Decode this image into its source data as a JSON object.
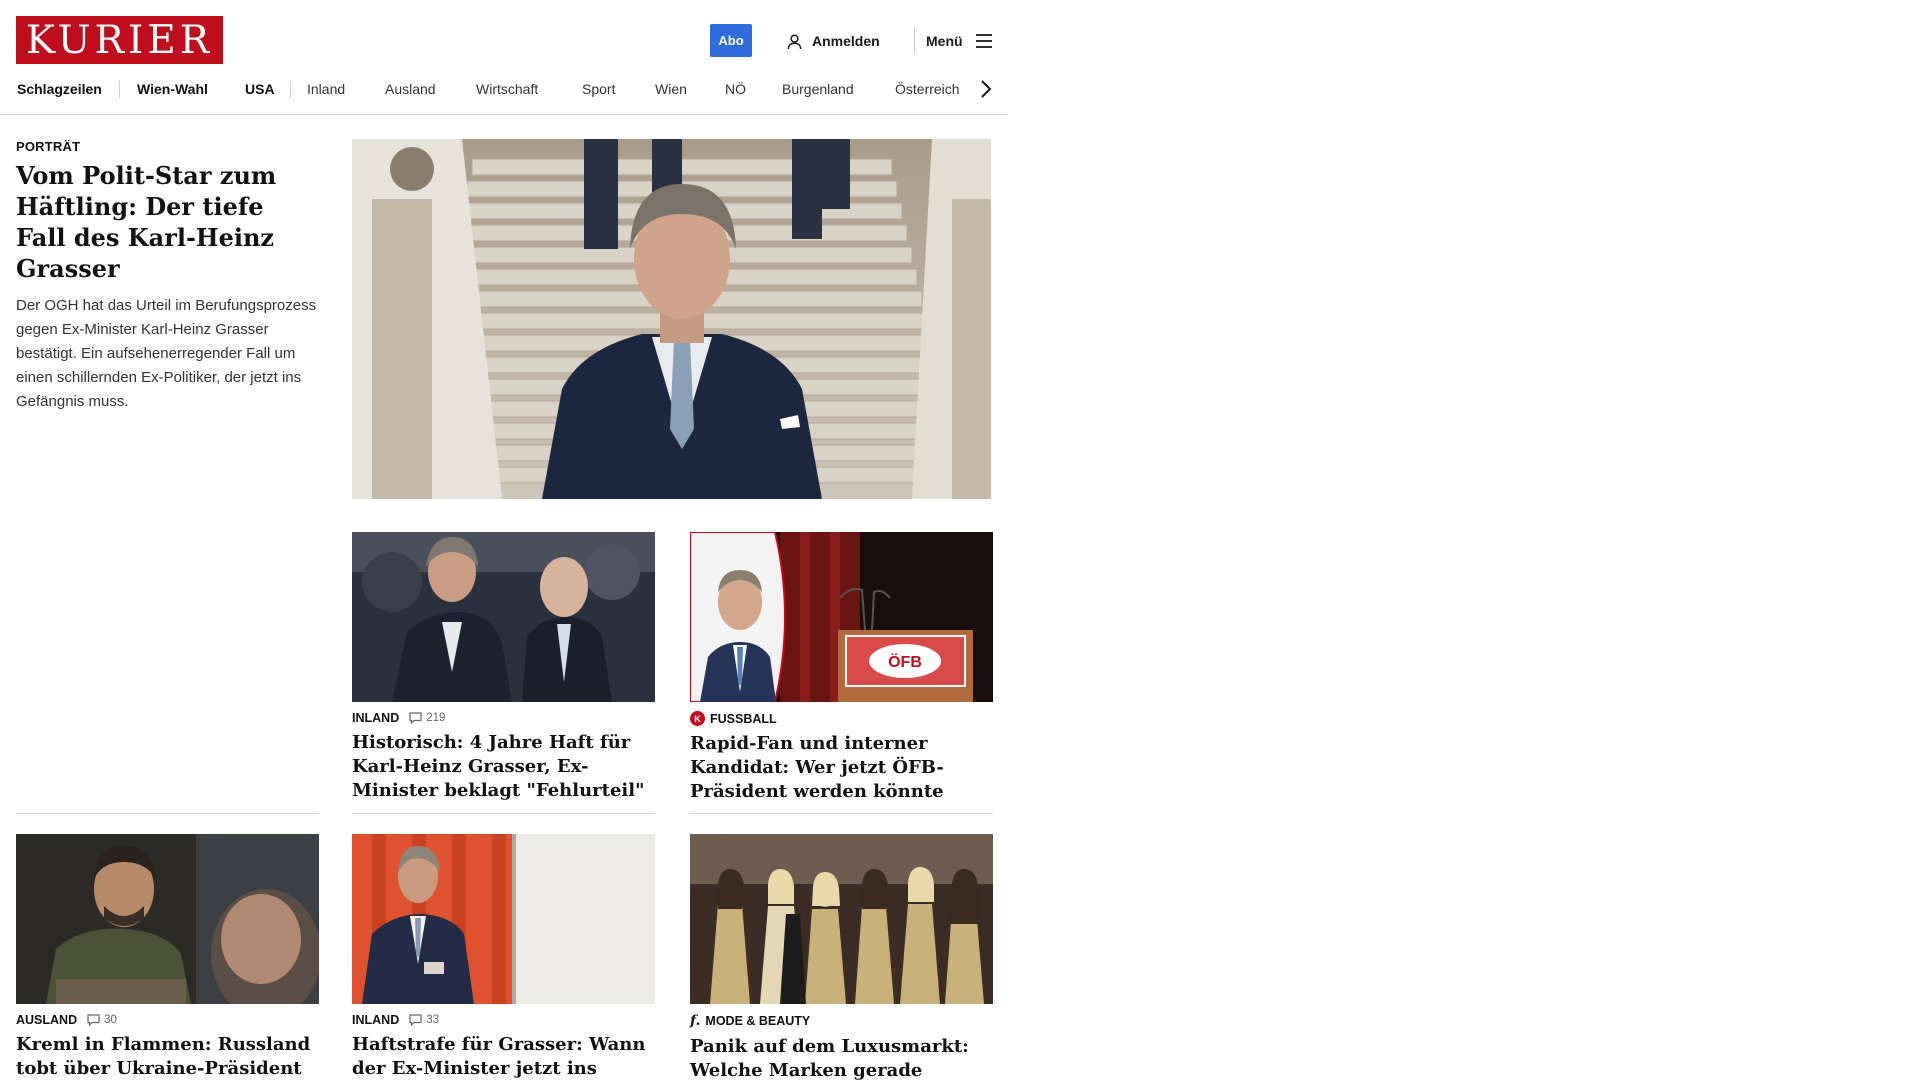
{
  "header": {
    "logo_text": "KURIER",
    "abo_label": "Abo",
    "login_label": "Anmelden",
    "menu_label": "Menü"
  },
  "nav": {
    "items": [
      "Schlagzeilen",
      "Wien-Wahl",
      "USA",
      "Inland",
      "Ausland",
      "Wirtschaft",
      "Sport",
      "Wien",
      "NÖ",
      "Burgenland",
      "Österreich"
    ]
  },
  "lead": {
    "kicker": "PORTRÄT",
    "title": "Vom Polit-Star zum Häftling: Der tiefe Fall des Karl-Heinz Grasser",
    "teaser": "Der OGH hat das Urteil im Berufungsprozess gegen Ex-Minister Karl-Heinz Grasser bestätigt. Ein aufsehenerregender Fall um einen schillernden Ex-Politiker, der jetzt ins Gefängnis muss."
  },
  "cards": [
    {
      "category": "INLAND",
      "comments": "219",
      "title": "Historisch: 4 Jahre Haft für Karl-Heinz Grasser, Ex-Minister beklagt \"Fehlurteil\""
    },
    {
      "category": "FUSSBALL",
      "badge": "K",
      "title": "Rapid-Fan und interner Kandidat: Wer jetzt ÖFB-Präsident werden könnte",
      "podium_text": "ÖFB"
    },
    {
      "category": "AUSLAND",
      "comments": "30",
      "title": "Kreml in Flammen: Russland tobt über Ukraine-Präsident Selenskij"
    },
    {
      "category": "INLAND",
      "comments": "33",
      "title": "Haftstrafe für Grasser: Wann der Ex-Minister jetzt ins Gefängnis muss"
    },
    {
      "category": "MODE & BEAUTY",
      "badge": "f.",
      "title": "Panik auf dem Luxusmarkt: Welche Marken gerade straucheln"
    }
  ],
  "colors": {
    "brand_red": "#c00d1e",
    "abo_blue": "#2f6bdc"
  }
}
